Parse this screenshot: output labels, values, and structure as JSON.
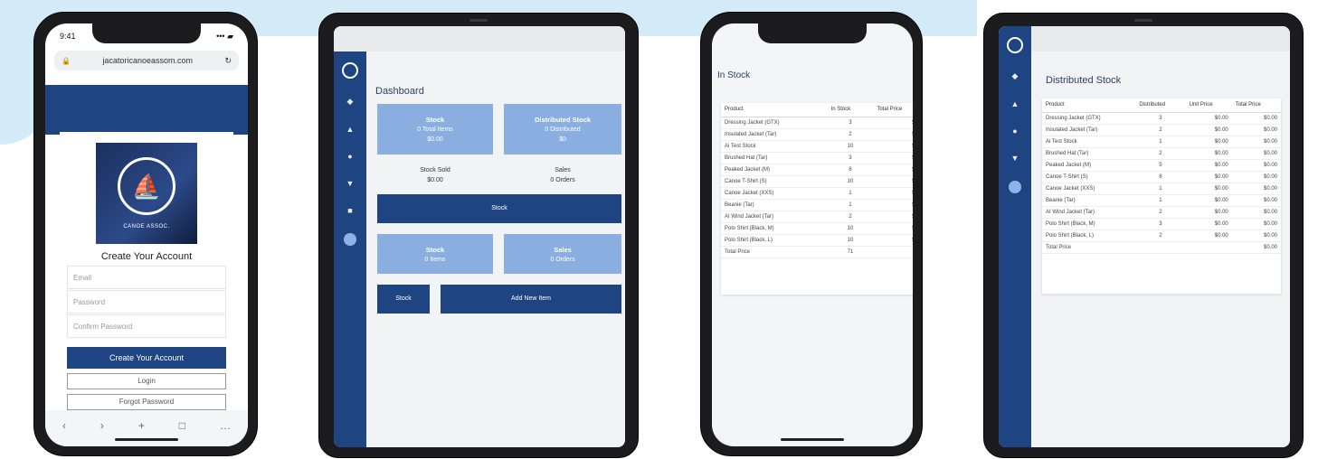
{
  "phone_register": {
    "status_time": "9:41",
    "status_icons": "••• ▰",
    "url": "jacatoricanoeassom.com",
    "logo_text": "CANOE ASSOC.",
    "title": "Create Your Account",
    "fields": [
      {
        "placeholder": "Email"
      },
      {
        "placeholder": "Password"
      },
      {
        "placeholder": "Confirm Password"
      }
    ],
    "create_button": "Create Your Account",
    "login_button": "Login",
    "forgot_button": "Forgot Password",
    "nav_icons": [
      "‹",
      "›",
      "+",
      "□",
      "…"
    ]
  },
  "tablet_dashboard": {
    "title": "Dashboard",
    "tiles": [
      {
        "title": "Stock",
        "line1": "0 Total Items",
        "line2": "$0.00"
      },
      {
        "title": "Distributed Stock",
        "line1": "0 Distributed",
        "line2": "$0"
      }
    ],
    "stats": [
      {
        "title": "Stock Sold",
        "value": "$0.00"
      },
      {
        "title": "Sales",
        "value": "0 Orders"
      }
    ],
    "wide_button": "Stock",
    "tiles2": [
      {
        "title": "Stock",
        "line1": "0 Items"
      },
      {
        "title": "Sales",
        "line1": "0 Orders"
      }
    ],
    "small_button": "Stock",
    "long_button": "Add New Item"
  },
  "phone_stock": {
    "title": "In Stock",
    "columns": [
      "Product",
      "In Stock",
      "Total Price"
    ],
    "rows": [
      [
        "Dressing Jacket (GTX)",
        "3",
        "$0.00"
      ],
      [
        "Insulated Jacket (Tar)",
        "2",
        "$0.00"
      ],
      [
        "Ai Test Stock",
        "10",
        "$0.00"
      ],
      [
        "Brushed Hat (Tar)",
        "3",
        "$0.00"
      ],
      [
        "Peaked Jacket (M)",
        "8",
        "$0.00"
      ],
      [
        "Canoe T-Shirt (S)",
        "10",
        "$0.00"
      ],
      [
        "Canoe Jacket (XXS)",
        "1",
        "$0.00"
      ],
      [
        "Beanie (Tar)",
        "1",
        "$0.00"
      ],
      [
        "AI Wind Jacket (Tar)",
        "2",
        "$0.00"
      ],
      [
        "Polo Shirt (Black, M)",
        "10",
        "$0.00"
      ],
      [
        "Polo Shirt (Black, L)",
        "10",
        "$0.00"
      ],
      [
        "Total Price",
        "71",
        ""
      ]
    ]
  },
  "tablet_distributed": {
    "title": "Distributed Stock",
    "columns": [
      "Product",
      "Distributed",
      "Unit Price",
      "Total Price"
    ],
    "rows": [
      [
        "Dressing Jacket (GTX)",
        "3",
        "$0.00",
        "$0.00"
      ],
      [
        "Insulated Jacket (Tar)",
        "2",
        "$0.00",
        "$0.00"
      ],
      [
        "Ai Test Stock",
        "1",
        "$0.00",
        "$0.00"
      ],
      [
        "Brushed Hat (Tar)",
        "2",
        "$0.00",
        "$0.00"
      ],
      [
        "Peaked Jacket (M)",
        "5",
        "$0.00",
        "$0.00"
      ],
      [
        "Canoe T-Shirt (S)",
        "8",
        "$0.00",
        "$0.00"
      ],
      [
        "Canoe Jacket (XXS)",
        "1",
        "$0.00",
        "$0.00"
      ],
      [
        "Beanie (Tar)",
        "1",
        "$0.00",
        "$0.00"
      ],
      [
        "AI Wind Jacket (Tar)",
        "2",
        "$0.00",
        "$0.00"
      ],
      [
        "Polo Shirt (Black, M)",
        "3",
        "$0.00",
        "$0.00"
      ],
      [
        "Polo Shirt (Black, L)",
        "2",
        "$0.00",
        "$0.00"
      ],
      [
        "Total Price",
        "",
        "",
        "$0.00"
      ]
    ]
  },
  "sidebar_items": [
    "◆",
    "▲",
    "●",
    "▼",
    "■"
  ]
}
